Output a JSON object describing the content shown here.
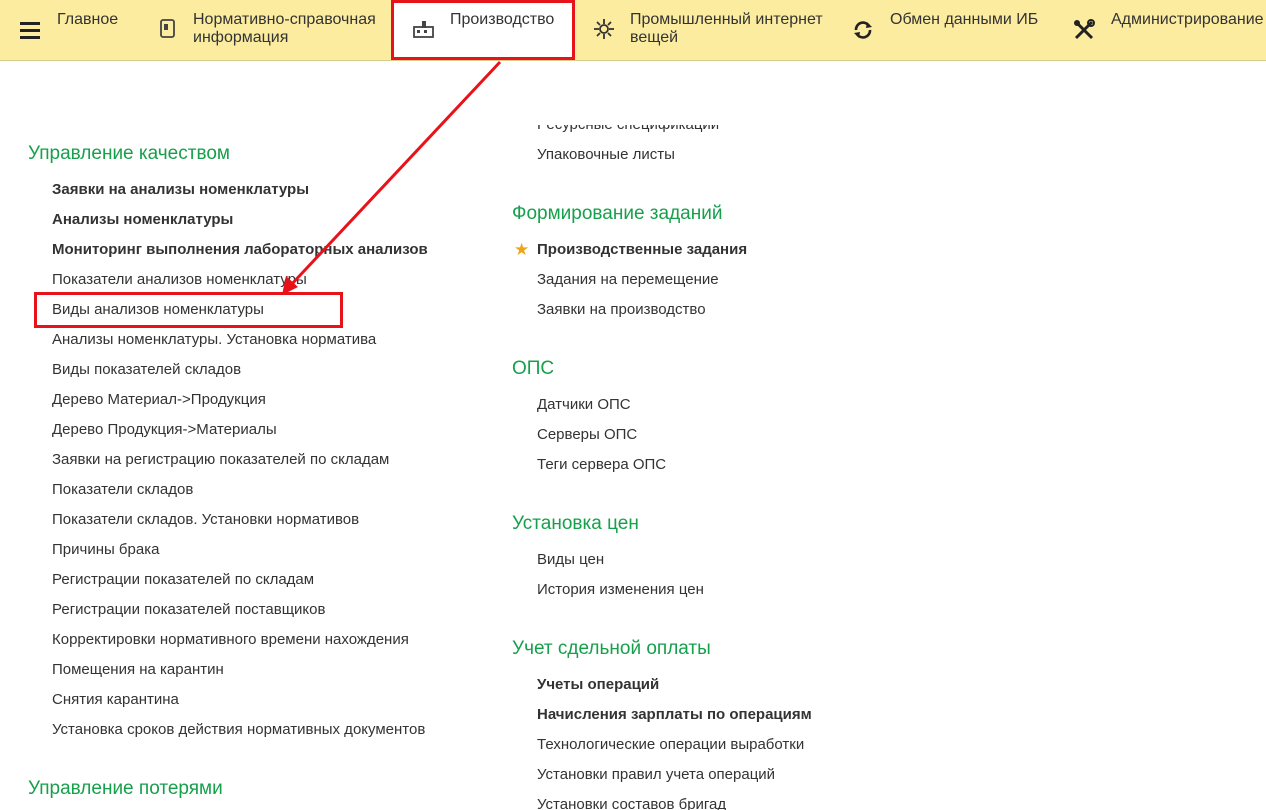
{
  "topbar": {
    "tabs": [
      {
        "label": "Главное",
        "icon": "menu-icon"
      },
      {
        "label": "Нормативно-справочная\nинформация",
        "icon": "book-icon"
      },
      {
        "label": "Производство",
        "icon": "factory-icon"
      },
      {
        "label": "Промышленный интернет\nвещей",
        "icon": "iot-icon"
      },
      {
        "label": "Обмен данными ИБ",
        "icon": "sync-icon"
      },
      {
        "label": "Администрирование",
        "icon": "tools-icon"
      }
    ]
  },
  "left": {
    "quality": {
      "title": "Управление качеством",
      "items": [
        {
          "label": "Заявки на анализы номенклатуры",
          "bold": true
        },
        {
          "label": "Анализы номенклатуры",
          "bold": true
        },
        {
          "label": "Мониторинг выполнения лабораторных анализов",
          "bold": true
        },
        {
          "label": "Показатели анализов номенклатуры",
          "bold": false
        },
        {
          "label": "Виды анализов номенклатуры",
          "bold": false
        },
        {
          "label": "Анализы номенклатуры. Установка норматива",
          "bold": false
        },
        {
          "label": "Виды показателей складов",
          "bold": false
        },
        {
          "label": "Дерево Материал->Продукция",
          "bold": false
        },
        {
          "label": "Дерево Продукция->Материалы",
          "bold": false
        },
        {
          "label": "Заявки на регистрацию показателей по складам",
          "bold": false
        },
        {
          "label": "Показатели складов",
          "bold": false
        },
        {
          "label": "Показатели складов. Установки нормативов",
          "bold": false
        },
        {
          "label": "Причины брака",
          "bold": false
        },
        {
          "label": "Регистрации показателей по складам",
          "bold": false
        },
        {
          "label": "Регистрации показателей поставщиков",
          "bold": false
        },
        {
          "label": "Корректировки нормативного времени нахождения",
          "bold": false
        },
        {
          "label": "Помещения на карантин",
          "bold": false
        },
        {
          "label": "Снятия карантина",
          "bold": false
        },
        {
          "label": "Установка сроков действия нормативных документов",
          "bold": false
        }
      ]
    },
    "losses": {
      "title": "Управление потерями"
    }
  },
  "right": {
    "top_items": [
      {
        "label": "Ресурсные спецификации"
      },
      {
        "label": "Упаковочные листы"
      }
    ],
    "tasks": {
      "title": "Формирование заданий",
      "items": [
        {
          "label": "Производственные задания",
          "bold": true,
          "star": true
        },
        {
          "label": "Задания на перемещение",
          "bold": false
        },
        {
          "label": "Заявки на производство",
          "bold": false
        }
      ]
    },
    "ops": {
      "title": "ОПС",
      "items": [
        {
          "label": "Датчики ОПС"
        },
        {
          "label": "Серверы ОПС"
        },
        {
          "label": "Теги сервера ОПС"
        }
      ]
    },
    "prices": {
      "title": "Установка цен",
      "items": [
        {
          "label": "Виды цен"
        },
        {
          "label": "История изменения цен"
        }
      ]
    },
    "piecework": {
      "title": "Учет сдельной оплаты",
      "items": [
        {
          "label": "Учеты операций",
          "bold": true
        },
        {
          "label": "Начисления зарплаты по операциям",
          "bold": true
        },
        {
          "label": "Технологические операции выработки",
          "bold": false
        },
        {
          "label": "Установки правил учета операций",
          "bold": false
        },
        {
          "label": "Установки составов бригад",
          "bold": false
        }
      ]
    }
  },
  "colors": {
    "accent_green": "#16a04b",
    "highlight_red": "#e8121b",
    "topbar_bg": "#fbeca0",
    "star": "#f0a416"
  }
}
